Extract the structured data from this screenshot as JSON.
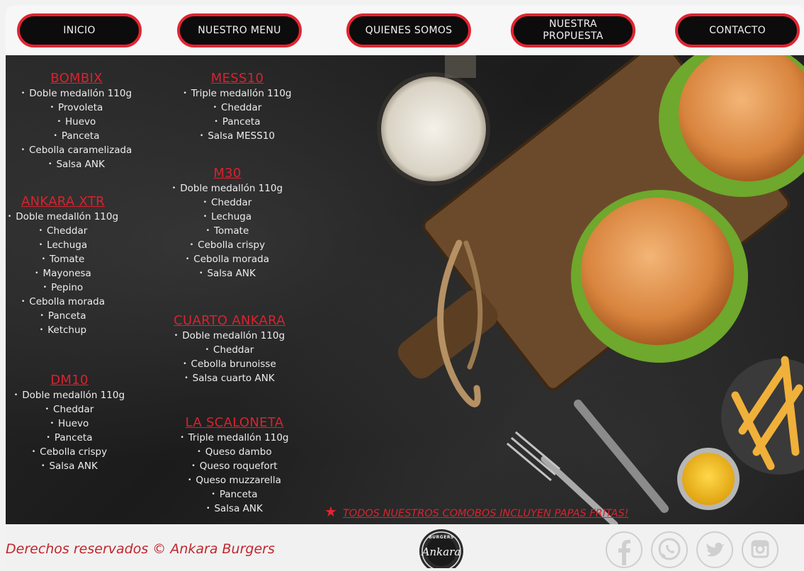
{
  "nav": {
    "items": [
      "INICIO",
      "NUESTRO MENU",
      "QUIENES SOMOS",
      "NUESTRA\nPROPUESTA",
      "CONTACTO"
    ]
  },
  "menu": {
    "bombix": {
      "title": "BOMBIX",
      "items": [
        "Doble medallón 110g",
        "Provoleta",
        "Huevo",
        "Panceta",
        "Cebolla caramelizada",
        "Salsa ANK"
      ]
    },
    "ankara_xtr": {
      "title": "ANKARA XTR",
      "items": [
        "Doble medallón 110g",
        "Cheddar",
        "Lechuga",
        "Tomate",
        "Mayonesa",
        "Pepino",
        "Cebolla morada",
        "Panceta",
        "Ketchup"
      ]
    },
    "dm10": {
      "title": "DM10",
      "items": [
        "Doble medallón 110g",
        "Cheddar",
        "Huevo",
        "Panceta",
        "Cebolla crispy",
        "Salsa ANK"
      ]
    },
    "mess10": {
      "title": "MESS10",
      "items": [
        "Triple medallón 110g",
        "Cheddar",
        "Panceta",
        "Salsa MESS10"
      ]
    },
    "m30": {
      "title": "M30",
      "items": [
        "Doble medallón 110g",
        "Cheddar",
        "Lechuga",
        "Tomate",
        "Cebolla crispy",
        "Cebolla morada",
        "Salsa ANK"
      ]
    },
    "cuarto_ankara": {
      "title": "CUARTO ANKARA",
      "items": [
        "Doble medallón 110g",
        "Cheddar",
        "Cebolla brunoisse",
        "Salsa cuarto ANK"
      ]
    },
    "la_scaloneta": {
      "title": "LA SCALONETA",
      "items": [
        "Triple medallón 110g",
        "Queso dambo",
        "Queso roquefort",
        "Queso muzzarella",
        "Panceta",
        "Salsa ANK"
      ]
    }
  },
  "promo": {
    "text": "TODOS NUESTROS COMOBOS INCLUYEN PAPAS FRITAS!",
    "icon": "star-icon"
  },
  "footer": {
    "copyright": "Derechos reservados © Ankara Burgers",
    "logo": {
      "top_text": "BURGERS",
      "name": "Ankara"
    },
    "social": [
      "facebook-icon",
      "whatsapp-icon",
      "twitter-icon",
      "instagram-icon"
    ]
  },
  "colors": {
    "accent": "#e2242f",
    "nav_bg": "#0c0c0c",
    "hero_bg": "#1e1e1e",
    "footer_bg": "#f1f1f1"
  }
}
